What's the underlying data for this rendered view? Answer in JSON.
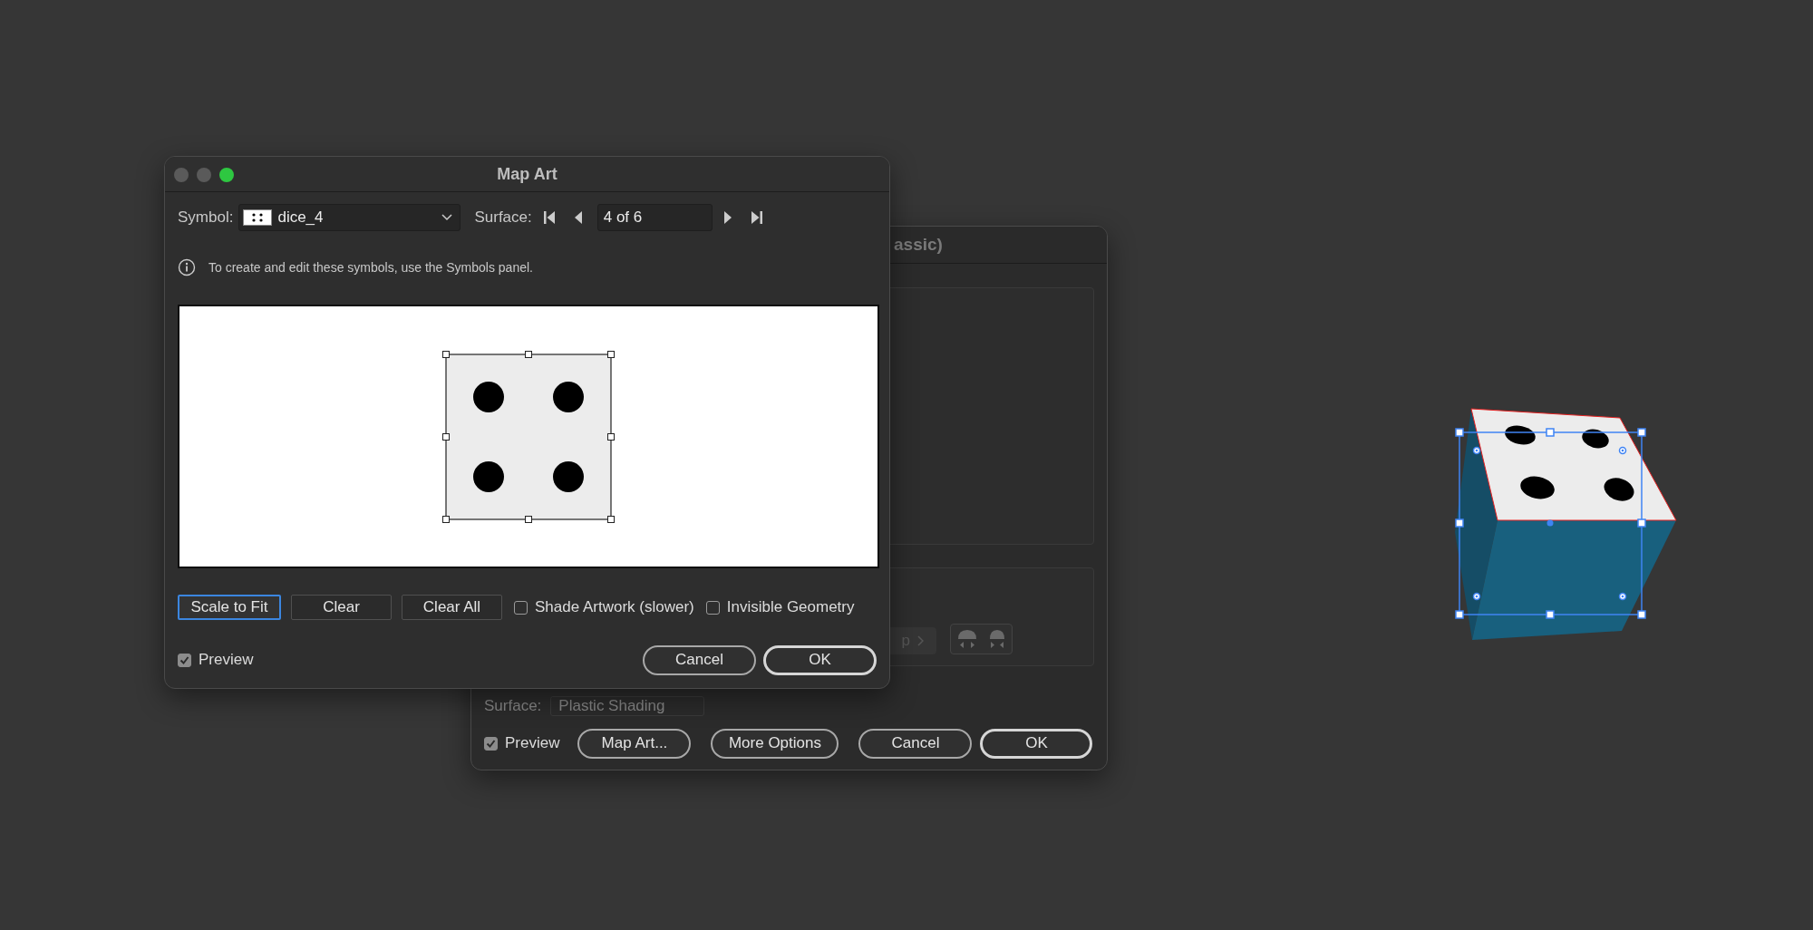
{
  "back_dialog": {
    "title": "assic)",
    "disabled_button_label": "p",
    "surface_label": "Surface:",
    "surface_value": "Plastic Shading",
    "preview": {
      "label": "Preview",
      "checked": true
    },
    "buttons": [
      {
        "label": "Map Art...",
        "default": false
      },
      {
        "label": "More Options",
        "default": false
      },
      {
        "label": "Cancel",
        "default": false
      },
      {
        "label": "OK",
        "default": true
      }
    ]
  },
  "map_art_dialog": {
    "title": "Map Art",
    "symbol_label": "Symbol:",
    "symbol_value": "dice_4",
    "surface_label": "Surface:",
    "surface_value": "4 of 6",
    "info": "To create and edit these symbols, use the Symbols panel.",
    "buttons": [
      {
        "label": "Scale to Fit",
        "focused": true
      },
      {
        "label": "Clear",
        "focused": false
      },
      {
        "label": "Clear All",
        "focused": false
      }
    ],
    "options": [
      {
        "label": "Shade Artwork (slower)",
        "checked": false
      },
      {
        "label": "Invisible Geometry",
        "checked": false
      }
    ],
    "preview": {
      "label": "Preview",
      "checked": true
    },
    "footer_buttons": [
      {
        "label": "Cancel",
        "default": false
      },
      {
        "label": "OK",
        "default": true
      }
    ]
  }
}
